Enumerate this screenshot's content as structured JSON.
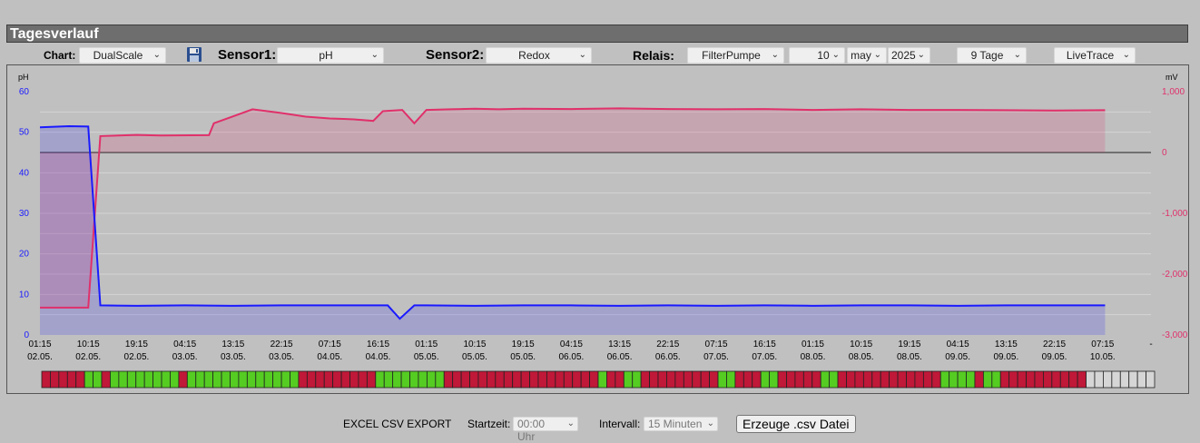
{
  "title": "Tagesverlauf",
  "controls": {
    "chart_label": "Chart:",
    "chart_value": "DualScale",
    "sensor1_label": "Sensor1:",
    "sensor1_value": "pH",
    "sensor2_label": "Sensor2:",
    "sensor2_value": "Redox",
    "relais_label": "Relais:",
    "relais_value": "FilterPumpe",
    "day": "10",
    "month": "may",
    "year": "2025",
    "range": "9 Tage",
    "mode": "LiveTrace",
    "chevron": "⌄"
  },
  "colors": {
    "sensor1": "#1a1aff",
    "sensor2": "#e0306a",
    "relay_on": "#55cc22",
    "relay_off": "#c01838",
    "relay_empty": "#d6d6d6"
  },
  "chart_data": {
    "type": "line",
    "left_axis": {
      "label": "pH",
      "ticks": [
        "0",
        "10",
        "20",
        "30",
        "40",
        "50",
        "60"
      ],
      "ylim": [
        0,
        60
      ]
    },
    "right_axis": {
      "label": "mV",
      "ticks": [
        "-3,000",
        "-2,000",
        "-1,000",
        "0",
        "1,000"
      ],
      "ylim": [
        -3000,
        1000
      ]
    },
    "x_ticks": [
      [
        "01:15",
        "02.05."
      ],
      [
        "10:15",
        "02.05."
      ],
      [
        "19:15",
        "02.05."
      ],
      [
        "04:15",
        "03.05."
      ],
      [
        "13:15",
        "03.05."
      ],
      [
        "22:15",
        "03.05."
      ],
      [
        "07:15",
        "04.05."
      ],
      [
        "16:15",
        "04.05."
      ],
      [
        "01:15",
        "05.05."
      ],
      [
        "10:15",
        "05.05."
      ],
      [
        "19:15",
        "05.05."
      ],
      [
        "04:15",
        "06.05."
      ],
      [
        "13:15",
        "06.05."
      ],
      [
        "22:15",
        "06.05."
      ],
      [
        "07:15",
        "07.05."
      ],
      [
        "16:15",
        "07.05."
      ],
      [
        "01:15",
        "08.05."
      ],
      [
        "10:15",
        "08.05."
      ],
      [
        "19:15",
        "08.05."
      ],
      [
        "04:15",
        "09.05."
      ],
      [
        "13:15",
        "09.05."
      ],
      [
        "22:15",
        "09.05."
      ],
      [
        "07:15",
        "10.05."
      ],
      [
        "-",
        ""
      ]
    ],
    "grid": true,
    "series": [
      {
        "name": "pH",
        "axis": "left",
        "points": [
          [
            0,
            51.2
          ],
          [
            0.6,
            51.5
          ],
          [
            1.0,
            51.4
          ],
          [
            1.25,
            7.3
          ],
          [
            2,
            7.2
          ],
          [
            3,
            7.3
          ],
          [
            4,
            7.2
          ],
          [
            5,
            7.3
          ],
          [
            6,
            7.3
          ],
          [
            7,
            7.3
          ],
          [
            7.2,
            7.3
          ],
          [
            7.45,
            4.0
          ],
          [
            7.75,
            7.3
          ],
          [
            8,
            7.3
          ],
          [
            9,
            7.2
          ],
          [
            10,
            7.3
          ],
          [
            11,
            7.3
          ],
          [
            12,
            7.2
          ],
          [
            13,
            7.3
          ],
          [
            14,
            7.2
          ],
          [
            15,
            7.3
          ],
          [
            16,
            7.2
          ],
          [
            17,
            7.3
          ],
          [
            18,
            7.3
          ],
          [
            19,
            7.2
          ],
          [
            20,
            7.3
          ],
          [
            21,
            7.3
          ],
          [
            22,
            7.3
          ],
          [
            22.05,
            7.3
          ]
        ]
      },
      {
        "name": "Redox",
        "axis": "right",
        "points": [
          [
            0,
            -2550
          ],
          [
            1.0,
            -2550
          ],
          [
            1.25,
            270
          ],
          [
            2,
            290
          ],
          [
            2.5,
            280
          ],
          [
            3.5,
            285
          ],
          [
            3.6,
            480
          ],
          [
            4.4,
            710
          ],
          [
            5.0,
            650
          ],
          [
            5.5,
            590
          ],
          [
            6,
            560
          ],
          [
            6.5,
            545
          ],
          [
            6.9,
            520
          ],
          [
            7.1,
            680
          ],
          [
            7.5,
            700
          ],
          [
            7.75,
            480
          ],
          [
            8.0,
            700
          ],
          [
            8.5,
            710
          ],
          [
            9,
            720
          ],
          [
            9.5,
            710
          ],
          [
            10,
            720
          ],
          [
            11,
            715
          ],
          [
            12,
            725
          ],
          [
            13,
            715
          ],
          [
            14,
            710
          ],
          [
            15,
            715
          ],
          [
            16,
            700
          ],
          [
            17,
            710
          ],
          [
            18,
            700
          ],
          [
            19,
            700
          ],
          [
            20,
            695
          ],
          [
            21,
            690
          ],
          [
            22,
            695
          ],
          [
            22.05,
            695
          ]
        ]
      }
    ],
    "relay_states": [
      0,
      0,
      0,
      0,
      0,
      1,
      1,
      0,
      1,
      1,
      1,
      1,
      1,
      1,
      1,
      1,
      0,
      1,
      1,
      1,
      1,
      1,
      1,
      1,
      1,
      1,
      1,
      1,
      1,
      1,
      0,
      0,
      0,
      0,
      0,
      0,
      0,
      0,
      0,
      1,
      1,
      1,
      1,
      1,
      1,
      1,
      1,
      0,
      0,
      0,
      0,
      0,
      0,
      0,
      0,
      0,
      0,
      0,
      0,
      0,
      0,
      0,
      0,
      0,
      0,
      1,
      0,
      0,
      1,
      1,
      0,
      0,
      0,
      0,
      0,
      0,
      0,
      0,
      0,
      1,
      1,
      0,
      0,
      0,
      1,
      1,
      0,
      0,
      0,
      0,
      0,
      1,
      1,
      0,
      0,
      0,
      0,
      0,
      0,
      0,
      0,
      0,
      0,
      0,
      0,
      1,
      1,
      1,
      1,
      0,
      1,
      1,
      0,
      0,
      0,
      0,
      0,
      0,
      0,
      0,
      0,
      0,
      -1,
      -1,
      -1,
      -1,
      -1,
      -1,
      -1,
      -1
    ]
  },
  "footer": {
    "export_label": "EXCEL CSV EXPORT",
    "start_label": "Startzeit:",
    "start_value": "00:00 Uhr",
    "interval_label": "Intervall:",
    "interval_value": "15 Minuten",
    "button_label": "Erzeuge .csv Datei"
  }
}
